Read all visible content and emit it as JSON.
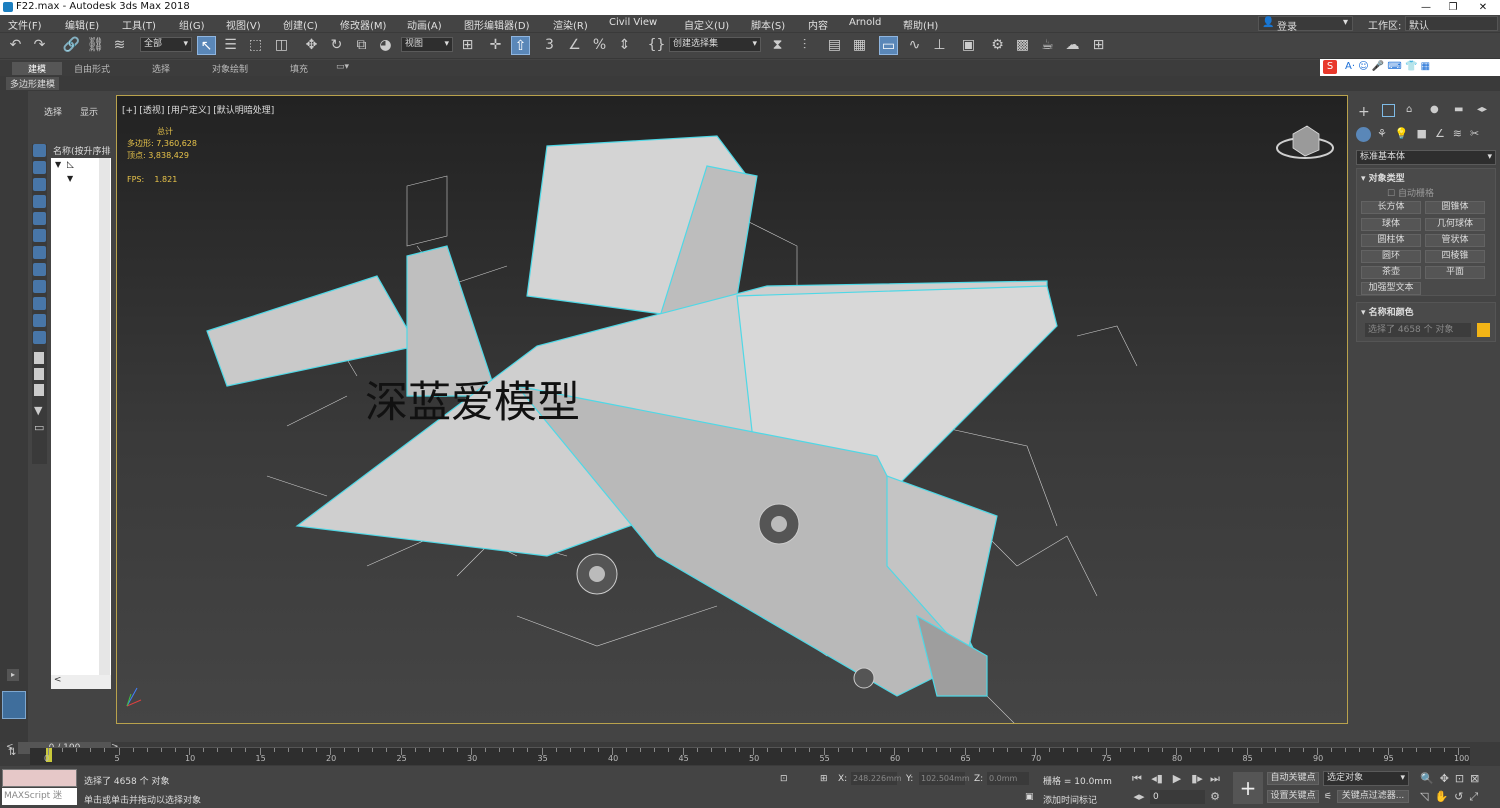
{
  "title": "F22.max - Autodesk 3ds Max 2018",
  "menu": [
    "文件(F)",
    "编辑(E)",
    "工具(T)",
    "组(G)",
    "视图(V)",
    "创建(C)",
    "修改器(M)",
    "动画(A)",
    "图形编辑器(D)",
    "渲染(R)",
    "Civil View",
    "自定义(U)",
    "脚本(S)",
    "内容",
    "Arnold",
    "帮助(H)"
  ],
  "login": "登录",
  "workspace_label": "工作区:",
  "workspace_value": "默认",
  "toolbar": {
    "filter": "全部",
    "refcoord": "视图",
    "selset": "创建选择集"
  },
  "ribbon": {
    "tabs": [
      "建模",
      "自由形式",
      "选择",
      "对象绘制",
      "填充"
    ],
    "sub": "多边形建模"
  },
  "scene": {
    "tab_select": "选择",
    "tab_display": "显示",
    "header": "名称(按升序排列)"
  },
  "viewport": {
    "label": "[+] [透视] [用户定义] [默认明暗处理]",
    "stats_title": "总计",
    "poly_label": "多边形:",
    "poly_value": "7,360,628",
    "vert_label": "顶点:",
    "vert_value": "3,838,429",
    "fps_label": "FPS:",
    "fps_value": "1.821",
    "watermark": "深蓝爱模型"
  },
  "cmd": {
    "dropdown": "标准基本体",
    "rollout1": "对象类型",
    "autogrid": "自动栅格",
    "buttons": [
      "长方体",
      "圆锥体",
      "球体",
      "几何球体",
      "圆柱体",
      "管状体",
      "圆环",
      "四棱锥",
      "茶壶",
      "平面",
      "加强型文本"
    ],
    "rollout2": "名称和颜色",
    "selected": "选择了 4658 个 对象"
  },
  "timeline": {
    "frame": "0 / 100",
    "ticks": [
      "0",
      "5",
      "10",
      "15",
      "20",
      "25",
      "30",
      "35",
      "40",
      "45",
      "50",
      "55",
      "60",
      "65",
      "70",
      "75",
      "80",
      "85",
      "90",
      "95",
      "100"
    ]
  },
  "status": {
    "maxscript": "MAXScript 迷",
    "selected": "选择了 4658 个 对象",
    "hint": "单击或单击并拖动以选择对象",
    "x_label": "X:",
    "x_value": "248.226mm",
    "y_label": "Y:",
    "y_value": "102.504mm",
    "z_label": "Z:",
    "z_value": "0.0mm",
    "grid": "栅格 = 10.0mm",
    "addtime": "添加时间标记",
    "autokey": "自动关键点",
    "setkey": "设置关键点",
    "selected_obj": "选定对象",
    "keyfilter": "关键点过滤器...",
    "frame_field": "0"
  },
  "colors": {
    "accent": "#5a87b8",
    "viewport_border": "#b9a24c",
    "wire": "#4fd8e6",
    "swatch": "#f2b416"
  }
}
